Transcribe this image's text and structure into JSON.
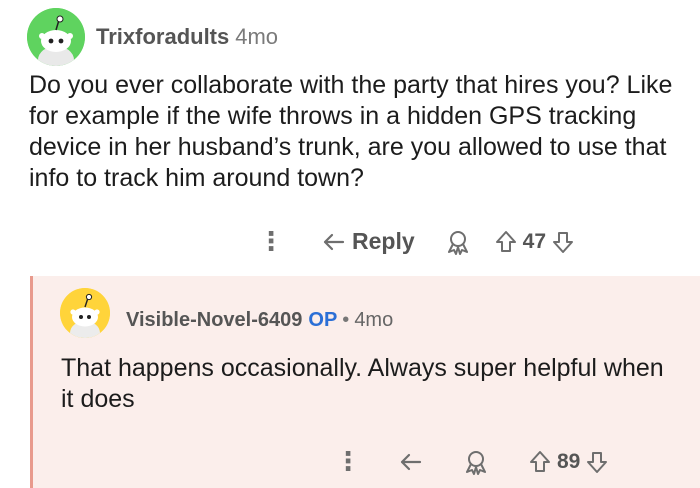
{
  "comments": [
    {
      "author": "Trixforadults",
      "time": "4mo",
      "body": "Do you ever collaborate with the party that hires you? Like for example if the wife throws in a hidden GPS tracking device in her husband’s trunk, are you allowed to use that info to track him around town?",
      "reply_label": "Reply",
      "votes": "47",
      "avatar_color": "#5fd35f"
    },
    {
      "author": "Visible-Novel-6409",
      "op_badge": "OP",
      "separator": "•",
      "time": "4mo",
      "body": "That happens occasionally. Always super helpful when it does",
      "votes": "89",
      "avatar_color": "#ffd43a",
      "thread_line_color": "#e89a8d",
      "background_color": "#fbeeeb"
    }
  ],
  "icons": {
    "more": "more-options-icon",
    "reply": "reply-arrow-icon",
    "award": "award-icon",
    "upvote": "upvote-icon",
    "downvote": "downvote-icon"
  }
}
